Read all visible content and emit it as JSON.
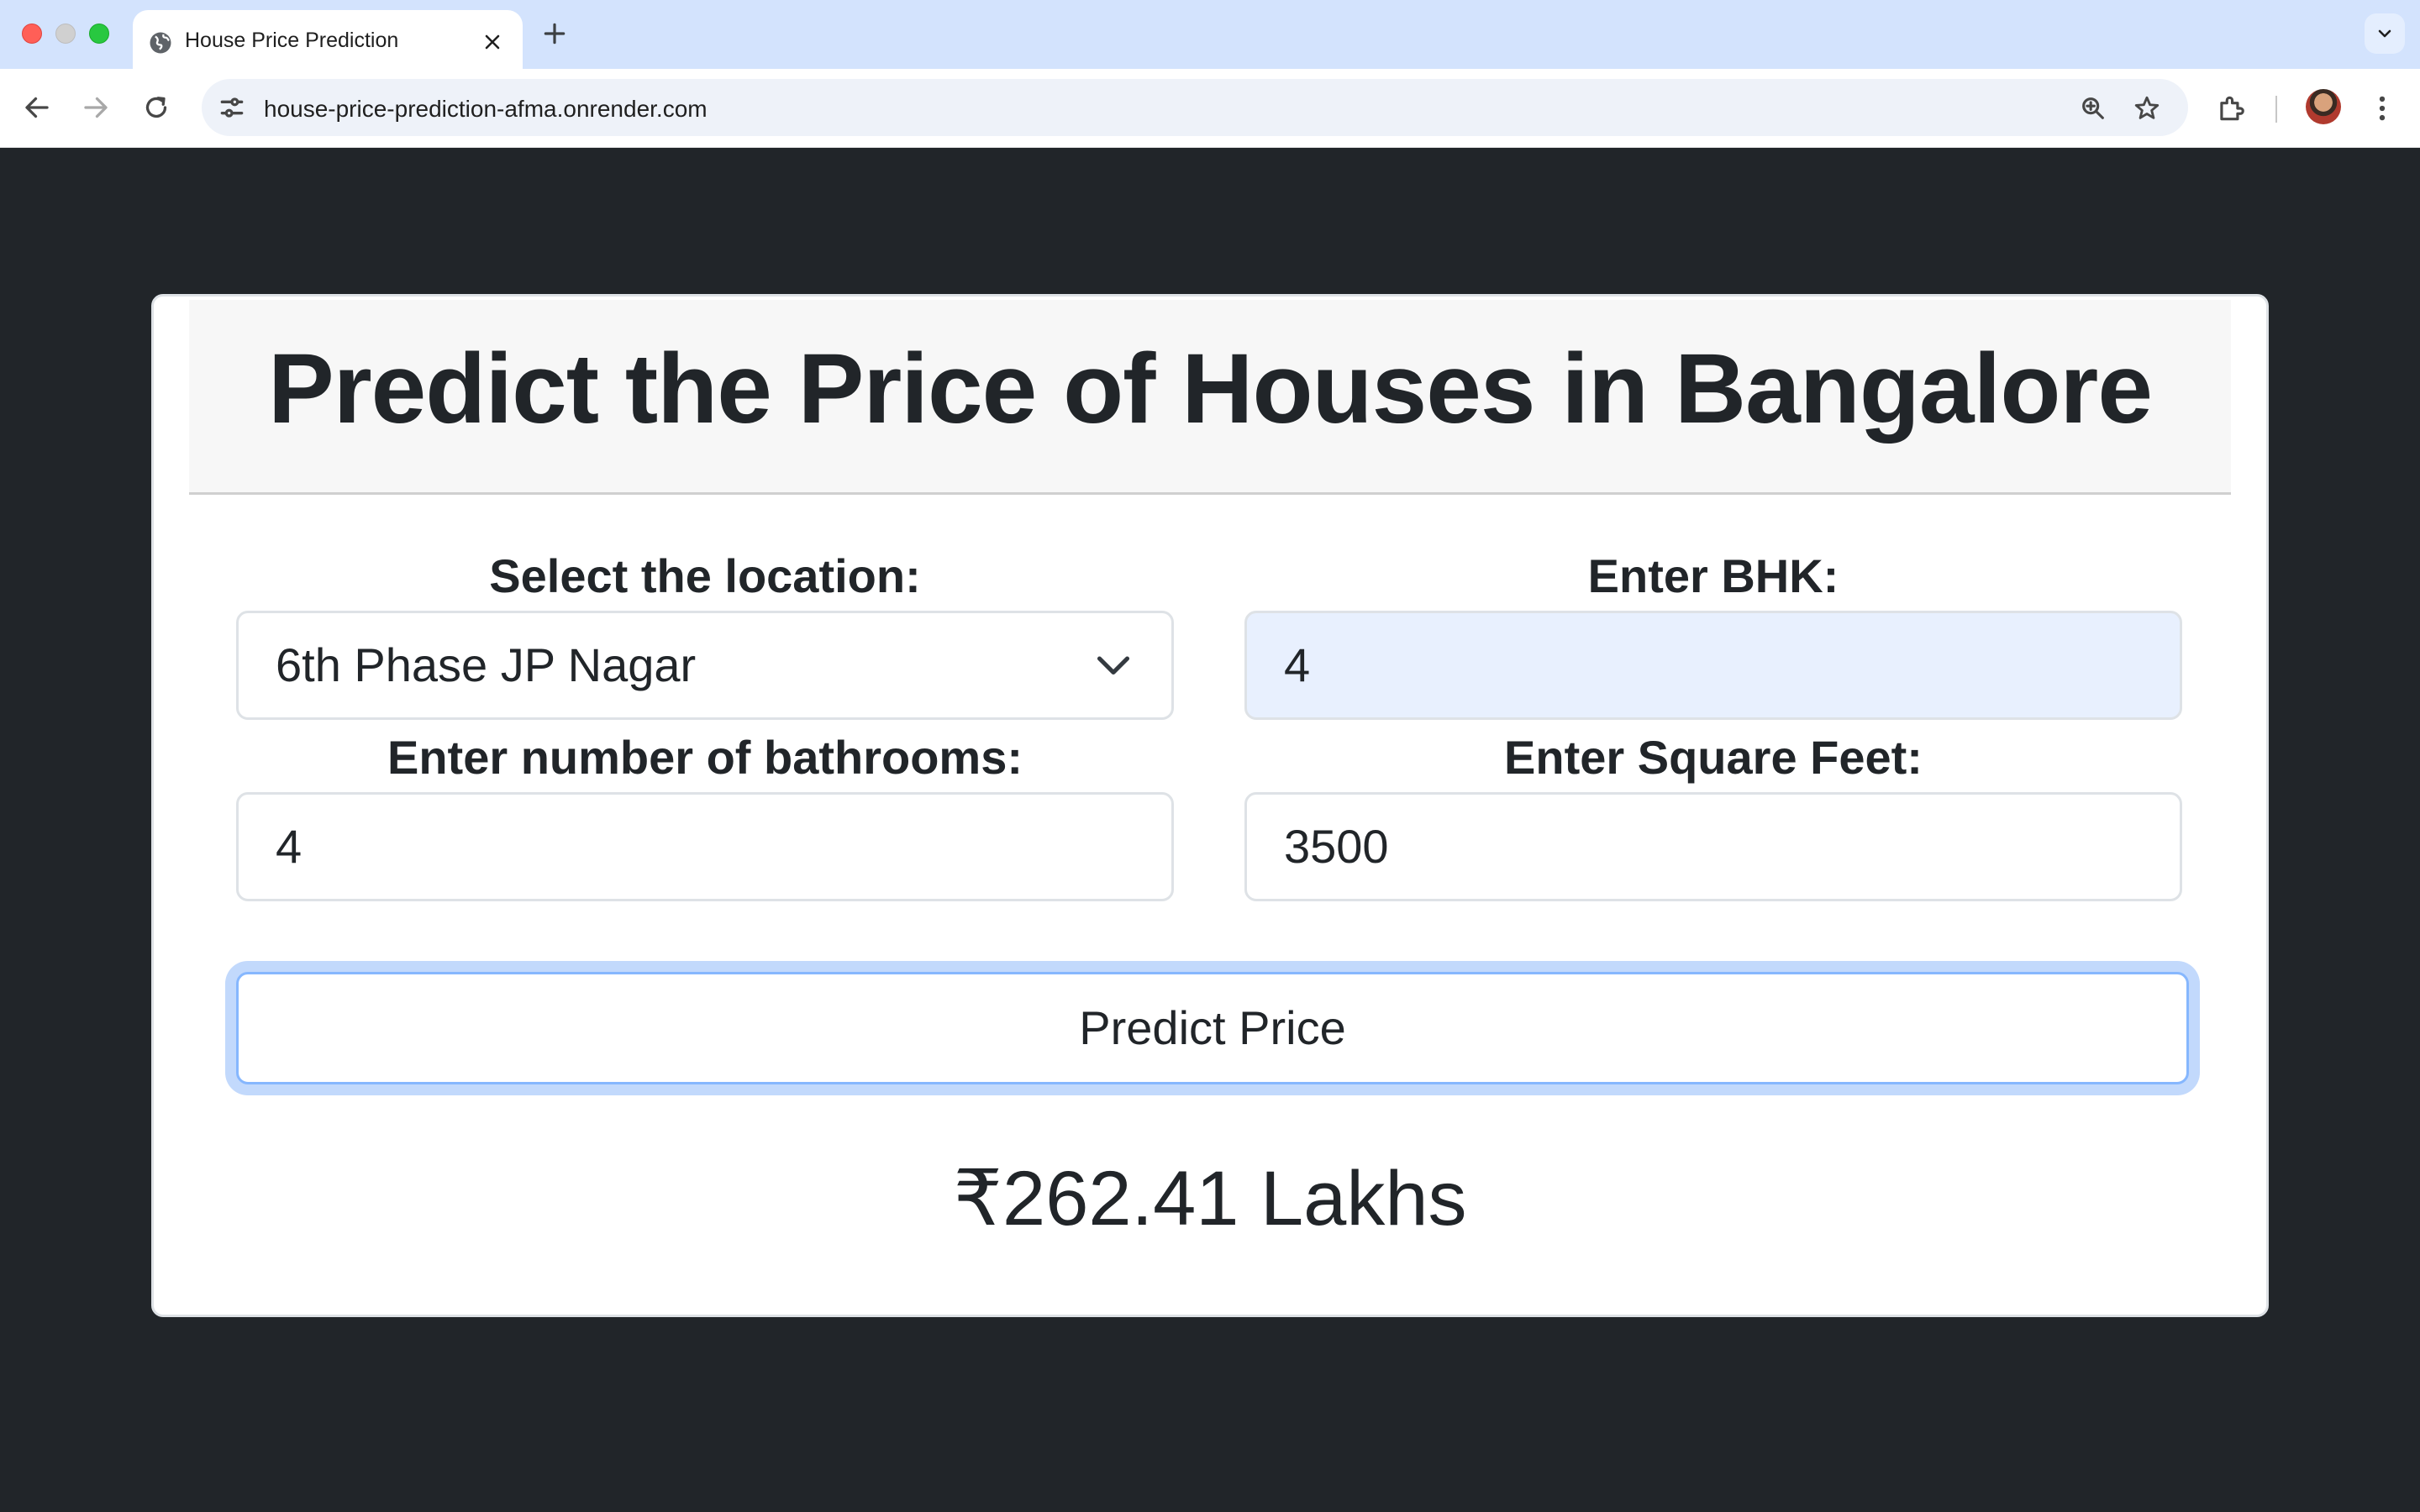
{
  "browser": {
    "tab_title": "House Price Prediction",
    "url": "house-price-prediction-afma.onrender.com"
  },
  "page": {
    "title": "Predict the Price of Houses in Bangalore",
    "location": {
      "label": "Select the location:",
      "value": "6th Phase JP Nagar"
    },
    "bhk": {
      "label": "Enter BHK:",
      "value": "4"
    },
    "bathrooms": {
      "label": "Enter number of bathrooms:",
      "value": "4"
    },
    "sqft": {
      "label": "Enter Square Feet:",
      "value": "3500"
    },
    "predict_label": "Predict Price",
    "result": "₹262.41 Lakhs"
  },
  "icons": {
    "favicon": "globe-icon",
    "close": "close-icon",
    "new_tab": "plus-icon",
    "tab_menu": "chevron-down-icon",
    "back": "back-arrow-icon",
    "forward": "forward-arrow-icon",
    "reload": "reload-icon",
    "site_info": "tune-icon",
    "zoom": "zoom-icon",
    "bookmark": "star-icon",
    "extensions": "puzzle-icon",
    "menu": "kebab-menu-icon"
  },
  "colors": {
    "page_background": "#212529",
    "tabbar": "#d3e3fd",
    "focus_ring": "#c2d9fc",
    "autofill": "#e8f0fe"
  }
}
